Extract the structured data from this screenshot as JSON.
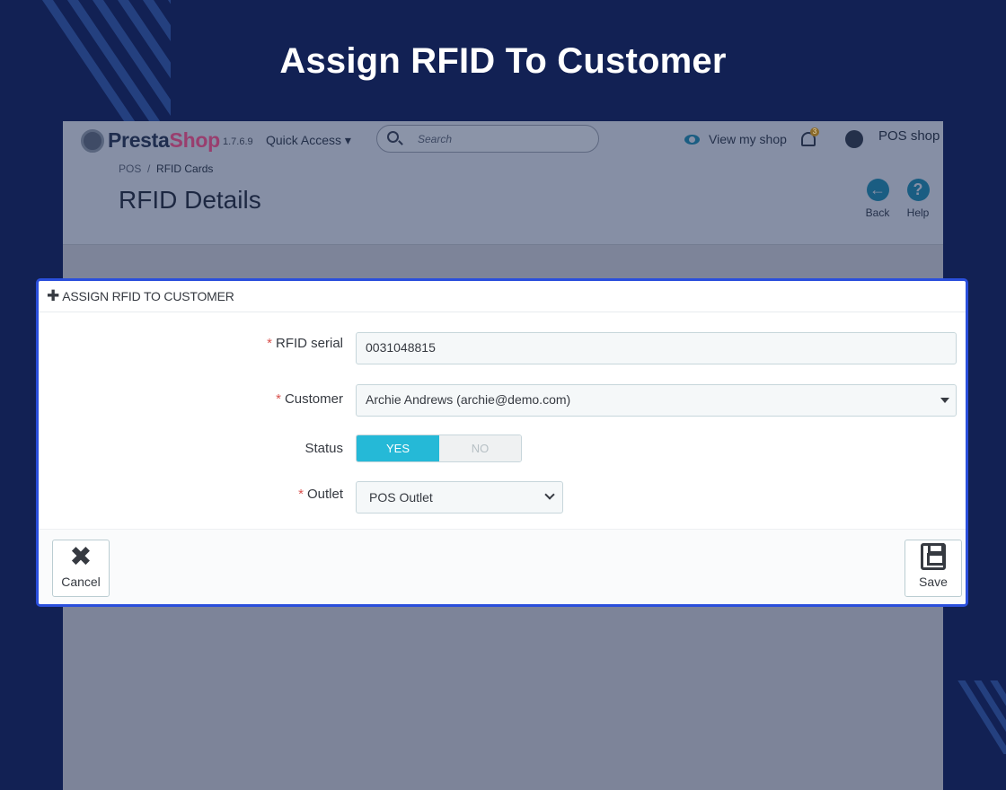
{
  "banner": {
    "title": "Assign RFID To Customer"
  },
  "admin": {
    "logo_presta": "Presta",
    "logo_shop": "Shop",
    "version": "1.7.6.9",
    "quick_access": "Quick Access ▾",
    "search_placeholder": "Search",
    "view_my_shop": "View my shop",
    "notification_count": "3",
    "shop_name": "POS shop",
    "breadcrumb": {
      "parent": "POS",
      "separator": "/",
      "current": "RFID Cards"
    },
    "page_title": "RFID Details",
    "toolbar": {
      "back": "Back",
      "help": "Help"
    }
  },
  "panel": {
    "heading": "ASSIGN RFID TO CUSTOMER",
    "fields": {
      "rfid_label": "RFID serial",
      "rfid_value": "0031048815",
      "customer_label": "Customer",
      "customer_value": "Archie Andrews (archie@demo.com)",
      "status_label": "Status",
      "status_yes": "YES",
      "status_no": "NO",
      "outlet_label": "Outlet",
      "outlet_value": "POS Outlet"
    },
    "required_mark": "*",
    "footer": {
      "cancel": "Cancel",
      "save": "Save"
    }
  },
  "colors": {
    "accent": "#25b9d7",
    "modal_border": "#2a4fdc",
    "background": "#122154"
  },
  "icons": [
    "search-icon",
    "eye-icon",
    "bell-icon",
    "user-icon",
    "back-icon",
    "help-icon",
    "plus-icon",
    "caret-down-icon",
    "chevron-down-icon",
    "close-icon",
    "save-icon"
  ]
}
